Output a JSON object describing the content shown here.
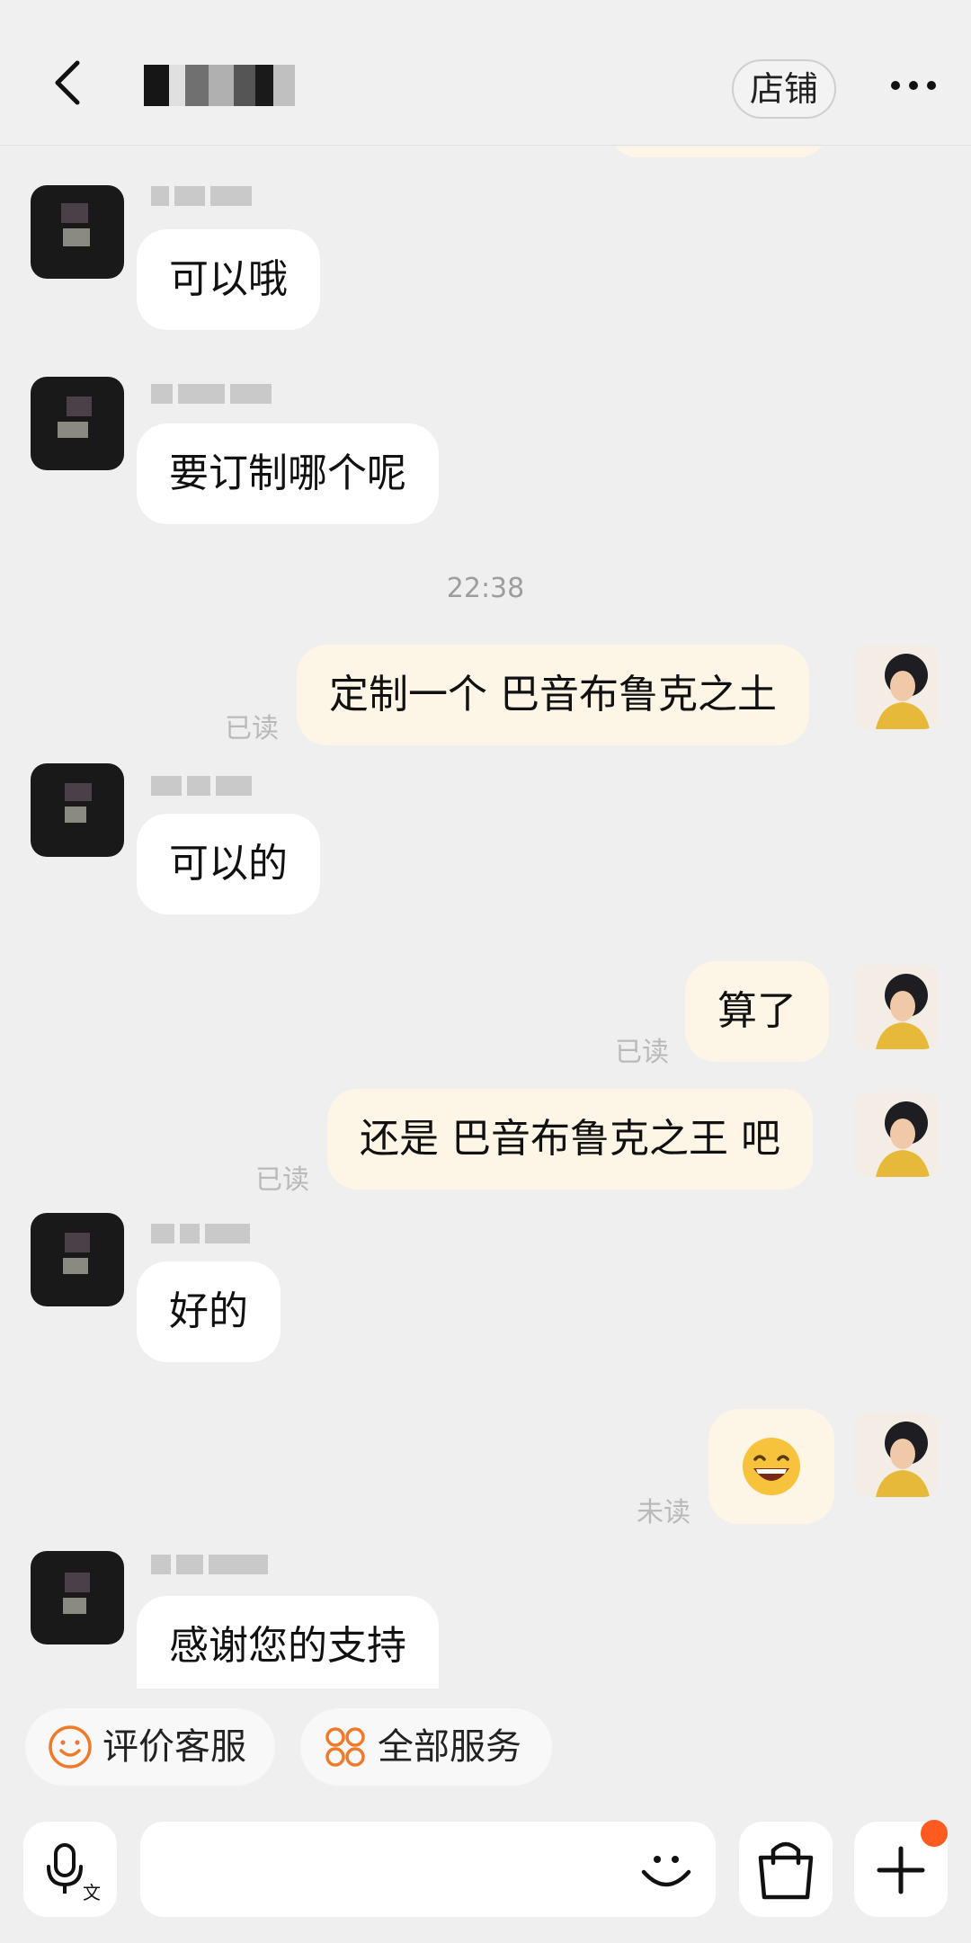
{
  "header": {
    "back_icon": "chevron-left-icon",
    "shop_label": "店铺",
    "more_icon": "more-dots-icon"
  },
  "messages": [
    {
      "side": "in",
      "text": "可以哦"
    },
    {
      "side": "in",
      "text": "要订制哪个呢"
    },
    {
      "side": "time",
      "text": "22:38"
    },
    {
      "side": "out",
      "text": "定制一个 巴音布鲁克之土",
      "status": "已读"
    },
    {
      "side": "in",
      "text": "可以的"
    },
    {
      "side": "out",
      "text": "算了",
      "status": "已读"
    },
    {
      "side": "out",
      "text": "还是 巴音布鲁克之王 吧",
      "status": "已读"
    },
    {
      "side": "in",
      "text": "好的"
    },
    {
      "side": "out",
      "text": "😄",
      "status": "未读"
    },
    {
      "side": "in",
      "text": "感谢您的支持"
    }
  ],
  "chips": [
    {
      "label": "评价客服",
      "icon": "smile-face-icon"
    },
    {
      "label": "全部服务",
      "icon": "services-grid-icon"
    }
  ],
  "inputbar": {
    "voice_icon": "voice-translate-icon",
    "emoji_icon": "emoji-icon",
    "bag_icon": "shopping-bag-icon",
    "plus_icon": "plus-icon"
  },
  "colors": {
    "background": "#efefef",
    "incoming_bubble": "#ffffff",
    "outgoing_bubble": "#fdf6e6",
    "accent": "#ff5a1f",
    "chip_icon": "#f07a2a"
  }
}
